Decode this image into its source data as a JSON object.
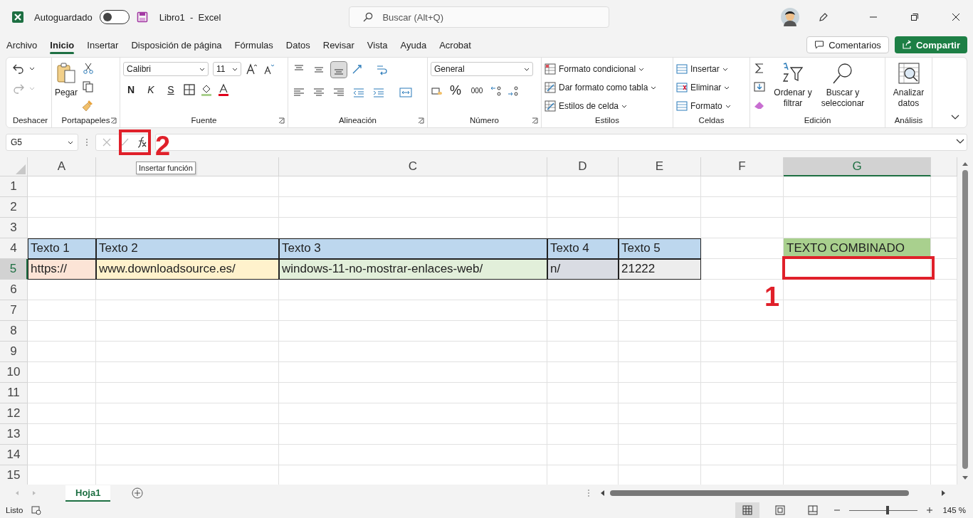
{
  "title_bar": {
    "autosave_label": "Autoguardado",
    "autosave_on": false,
    "document_title": "Libro1  -  Excel",
    "search": {
      "placeholder": "Buscar (Alt+Q)"
    }
  },
  "ribbon_tabs": [
    {
      "label": "Archivo",
      "selected": false
    },
    {
      "label": "Inicio",
      "selected": true
    },
    {
      "label": "Insertar",
      "selected": false
    },
    {
      "label": "Disposición de página",
      "selected": false
    },
    {
      "label": "Fórmulas",
      "selected": false
    },
    {
      "label": "Datos",
      "selected": false
    },
    {
      "label": "Revisar",
      "selected": false
    },
    {
      "label": "Vista",
      "selected": false
    },
    {
      "label": "Ayuda",
      "selected": false
    },
    {
      "label": "Acrobat",
      "selected": false
    }
  ],
  "buttons": [
    {
      "label": "Comentarios",
      "kind": "outline"
    },
    {
      "label": "Compartir",
      "kind": "primary"
    }
  ],
  "ribbon": {
    "undo": {
      "label": "Deshacer"
    },
    "clipboard": {
      "label": "Portapapeles",
      "launcher": true,
      "paste": "Pegar"
    },
    "font": {
      "label": "Fuente",
      "launcher": true,
      "family": "Calibri",
      "size": "11",
      "bold": "N",
      "italic": "K",
      "underline": "S"
    },
    "alignment": {
      "label": "Alineación",
      "launcher": true,
      "vertical": [
        {
          "kind": "top",
          "selected": false
        },
        {
          "kind": "middle",
          "selected": false
        },
        {
          "kind": "bottom",
          "selected": true
        }
      ]
    },
    "number": {
      "label": "Número",
      "launcher": true,
      "format": "General",
      "percent": "%",
      "thousands": "000"
    },
    "styles": {
      "label": "Estilos",
      "items": [
        "Formato condicional",
        "Dar formato como tabla",
        "Estilos de celda"
      ]
    },
    "cells": {
      "label": "Celdas",
      "items": [
        "Insertar",
        "Eliminar",
        "Formato"
      ]
    },
    "editing": {
      "label": "Edición",
      "sort": "Ordenar y filtrar",
      "find": "Buscar y seleccionar"
    },
    "analysis": {
      "label": "Análisis",
      "analyze": "Analizar datos"
    }
  },
  "formula_bar": {
    "name_box": "G5",
    "tooltip": "Insertar función"
  },
  "sheet": {
    "columns": [
      {
        "label": "A",
        "selected": false
      },
      {
        "selected": false
      },
      {
        "label": "C",
        "selected": false
      },
      {
        "label": "D",
        "selected": false
      },
      {
        "label": "E",
        "selected": false
      },
      {
        "label": "F",
        "selected": false
      },
      {
        "label": "G",
        "selected": true
      }
    ],
    "rows": [
      {
        "label": "1",
        "selected": false
      },
      {
        "label": "2",
        "selected": false
      },
      {
        "label": "3",
        "selected": false
      },
      {
        "label": "4",
        "selected": false,
        "cells": [
          {
            "text": "Texto 1",
            "color": "#bdd7ee",
            "bordered": true
          },
          {
            "text": "Texto 2",
            "color": "#bdd7ee",
            "bordered": true
          },
          {
            "text": "Texto 3",
            "color": "#bdd7ee",
            "bordered": true
          },
          {
            "text": "Texto 4",
            "color": "#bdd7ee",
            "bordered": true
          },
          {
            "text": "Texto 5",
            "color": "#bdd7ee",
            "bordered": true
          },
          null,
          {
            "text": "TEXTO COMBINADO",
            "color": "#a9d08e",
            "bordered": false
          }
        ]
      },
      {
        "label": "5",
        "selected": true,
        "cells": [
          {
            "text": "https://",
            "color": "#fce4d6",
            "bordered": true
          },
          {
            "text": "www.downloadsource.es/",
            "color": "#fff2cc",
            "bordered": true
          },
          {
            "text": "windows-11-no-mostrar-enlaces-web/",
            "color": "#e2efda",
            "bordered": true
          },
          {
            "text": "n/",
            "color": "#d9dce3",
            "bordered": true
          },
          {
            "text": "21222",
            "color": "#ededed",
            "bordered": true
          }
        ]
      },
      {
        "label": "6",
        "selected": false
      },
      {
        "label": "7",
        "selected": false
      },
      {
        "label": "8",
        "selected": false
      },
      {
        "label": "9",
        "selected": false
      },
      {
        "label": "10",
        "selected": false
      },
      {
        "label": "11",
        "selected": false
      },
      {
        "label": "12",
        "selected": false
      },
      {
        "label": "13",
        "selected": false
      },
      {
        "label": "14",
        "selected": false
      },
      {
        "label": "15",
        "selected": false
      }
    ]
  },
  "annotations": [
    {
      "label": "1"
    },
    {
      "label": "2"
    }
  ],
  "sheet_tabs": [
    {
      "label": "Hoja1",
      "selected": true
    }
  ],
  "status_bar": {
    "status": "Listo",
    "zoom": "145 %",
    "zoom_slider": {
      "level": 0.56
    }
  }
}
